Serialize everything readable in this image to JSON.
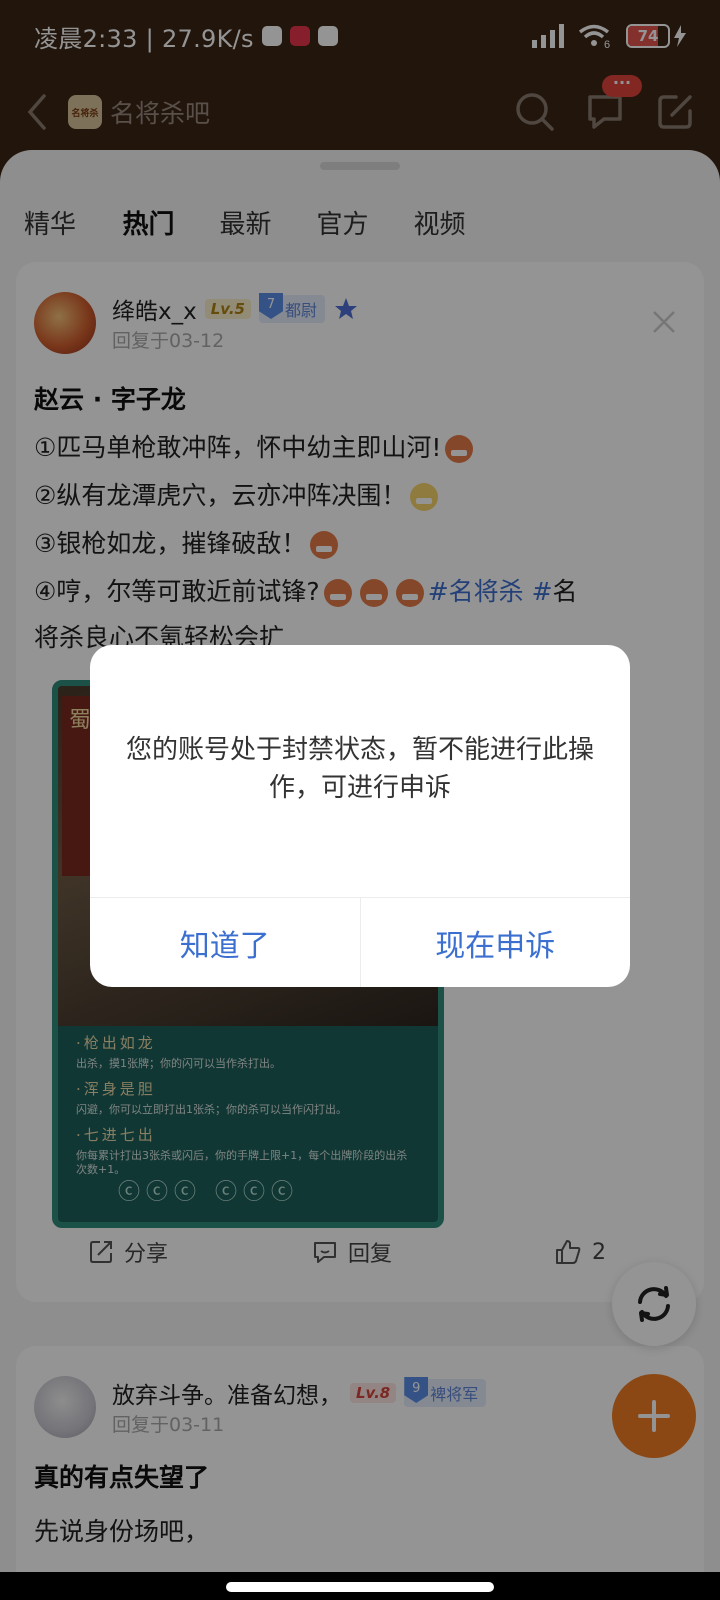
{
  "status_bar": {
    "time_speed": "凌晨2:33 | 27.9K/s",
    "battery": "74",
    "battery_level_percent": 74,
    "wifi_label": "6"
  },
  "header": {
    "forum_name": "名将杀吧",
    "message_badge": "···"
  },
  "tabs": [
    "精华",
    "热门",
    "最新",
    "官方",
    "视频"
  ],
  "active_tab": "热门",
  "post1": {
    "username": "绛皓x_x",
    "level": "Lv.5",
    "rank_num": "7",
    "rank": "都尉",
    "time": "回复于03-12",
    "title": "赵云 · 字子龙",
    "line1": "①匹马单枪敢冲阵，怀中幼主即山河!",
    "line2": "②纵有龙潭虎穴，云亦冲阵决围！",
    "line3": "③银枪如龙，摧锋破敌！",
    "line4_text": "④哼，尔等可敢近前试锋?",
    "line4_tag": "#名将杀 #",
    "line4_tail": "名",
    "line5": "将杀良心不氪轻松会扩"
  },
  "game_card": {
    "title_char": "蜀",
    "skills": [
      {
        "name": "·枪出如龙",
        "desc": "出杀，摸1张牌；你的闪可以当作杀打出。"
      },
      {
        "name": "·浑身是胆",
        "desc": "闪避，你可以立即打出1张杀；你的杀可以当作闪打出。"
      },
      {
        "name": "·七进七出",
        "desc": "你每累计打出3张杀或闪后，你的手牌上限+1，每个出牌阶段的出杀次数+1。"
      }
    ]
  },
  "actions": {
    "share": "分享",
    "reply": "回复",
    "like_count": "2"
  },
  "post2": {
    "username": "放弃斗争。准备幻想，",
    "level": "Lv.8",
    "rank_num": "9",
    "rank": "裨将军",
    "time": "回复于03-11",
    "title": "真的有点失望了",
    "line1": "先说身份场吧，"
  },
  "dialog": {
    "message": "您的账号处于封禁状态，暂不能进行此操作，可进行申诉",
    "cancel": "知道了",
    "confirm": "现在申诉"
  }
}
